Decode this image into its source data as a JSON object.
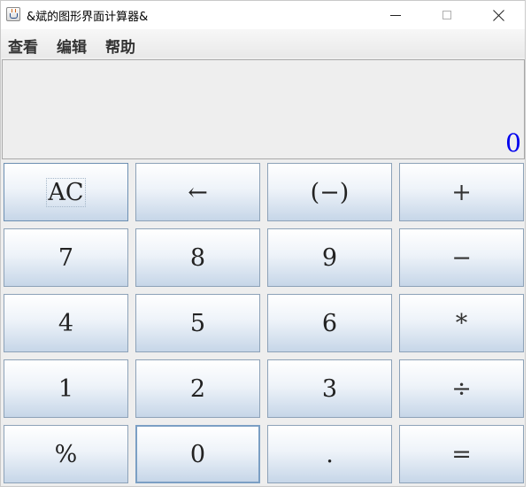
{
  "window": {
    "title": "&斌的图形界面计算器&"
  },
  "menu": {
    "view": "查看",
    "edit": "编辑",
    "help": "帮助"
  },
  "display": {
    "value": "0",
    "color": "#0000ee"
  },
  "keys": {
    "ac": "AC",
    "backspace": "←",
    "negate": "(−)",
    "plus": "+",
    "seven": "7",
    "eight": "8",
    "nine": "9",
    "minus": "−",
    "four": "4",
    "five": "5",
    "six": "6",
    "multiply": "*",
    "one": "1",
    "two": "2",
    "three": "3",
    "divide": "÷",
    "percent": "%",
    "zero": "0",
    "decimal": ".",
    "equals": "="
  },
  "icons": {
    "app": "java-cup-icon",
    "minimize": "minimize-icon",
    "maximize": "maximize-icon",
    "close": "close-icon"
  }
}
